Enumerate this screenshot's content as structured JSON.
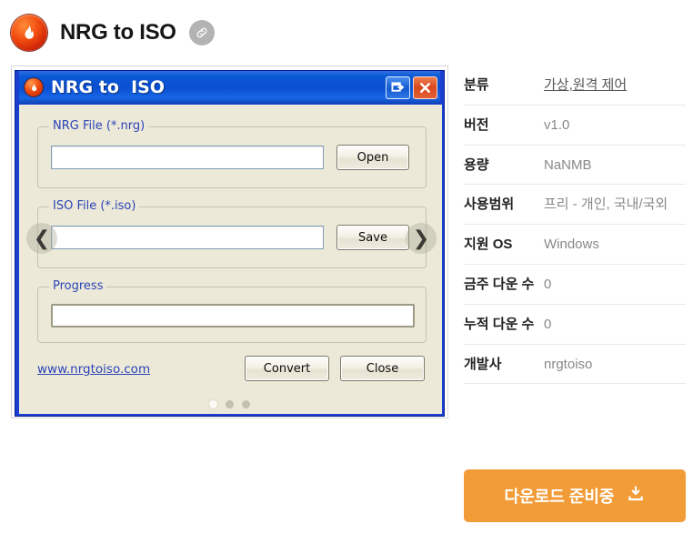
{
  "header": {
    "title": "NRG to ISO",
    "app_icon": "flame-icon",
    "link_icon": "link-icon"
  },
  "screenshot": {
    "window": {
      "titlebar": {
        "icon": "flame-icon",
        "title": "NRG to  ISO",
        "minimize_icon": "minimize-to-tray-icon",
        "close_icon": "close-icon"
      },
      "nrg_group": {
        "legend": "NRG File (*.nrg)",
        "input_value": "",
        "input_placeholder": "",
        "button": "Open"
      },
      "iso_group": {
        "legend": "ISO File (*.iso)",
        "input_value": "",
        "input_placeholder": "",
        "button": "Save"
      },
      "progress_group": {
        "legend": "Progress",
        "progress_percent": 0
      },
      "footer": {
        "website": "www.nrgtoiso.com",
        "convert_button": "Convert",
        "close_button": "Close"
      }
    },
    "carousel": {
      "prev_icon": "chevron-left-icon",
      "next_icon": "chevron-right-icon",
      "dot_count": 3,
      "active_dot_index": 0
    }
  },
  "info": {
    "rows": [
      {
        "label": "분류",
        "value": "가상,원격 제어",
        "is_link": true
      },
      {
        "label": "버전",
        "value": "v1.0",
        "is_link": false
      },
      {
        "label": "용량",
        "value": "NaNMB",
        "is_link": false
      },
      {
        "label": "사용범위",
        "value": "프리 - 개인, 국내/국외",
        "is_link": false
      },
      {
        "label": "지원 OS",
        "value": "Windows",
        "is_link": false
      },
      {
        "label": "금주 다운 수",
        "value": "0",
        "is_link": false
      },
      {
        "label": "누적 다운 수",
        "value": "0",
        "is_link": false
      },
      {
        "label": "개발사",
        "value": "nrgtoiso",
        "is_link": false
      }
    ]
  },
  "download": {
    "label": "다운로드 준비중",
    "icon": "download-icon",
    "color": "#f29c38"
  }
}
